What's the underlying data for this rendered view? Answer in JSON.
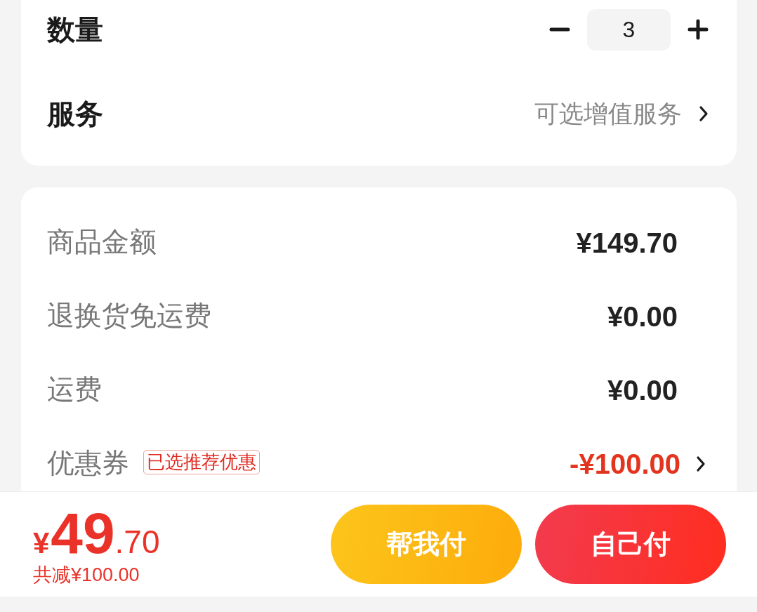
{
  "options": [
    {
      "kind": "stepper",
      "label": "数量",
      "value": "3"
    },
    {
      "kind": "link",
      "label": "服务",
      "hint": "可选增值服务"
    }
  ],
  "price_details": [
    {
      "kind": "amount",
      "label": "商品金额",
      "value": "¥149.70"
    },
    {
      "kind": "amount",
      "label": "退换货免运费",
      "value": "¥0.00"
    },
    {
      "kind": "amount",
      "label": "运费",
      "value": "¥0.00"
    },
    {
      "kind": "coupon",
      "label": "优惠券",
      "badge": "已选推荐优惠",
      "value": "-¥100.00"
    }
  ],
  "footer": {
    "total": {
      "currency": "¥",
      "integer": "49",
      "decimal": ".70"
    },
    "savings": "共减¥100.00",
    "buttons": [
      {
        "kind": "secondary",
        "label": "帮我付"
      },
      {
        "kind": "primary",
        "label": "自己付"
      }
    ]
  }
}
